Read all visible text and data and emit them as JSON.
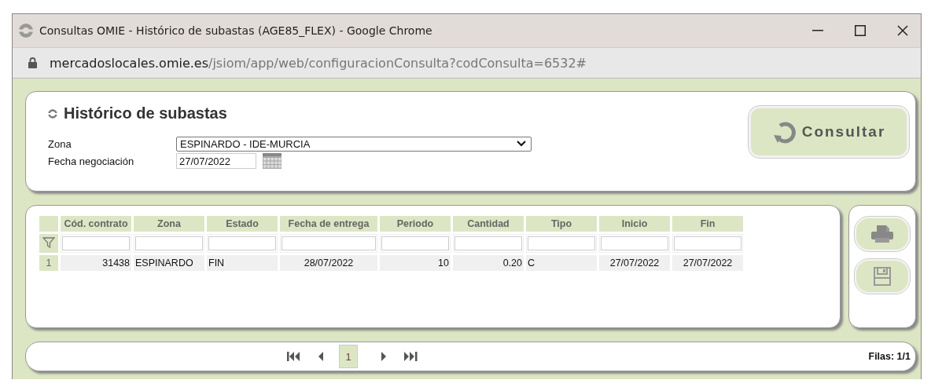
{
  "window": {
    "title": "Consultas OMIE - Histórico de subastas (AGE85_FLEX) - Google Chrome"
  },
  "address_bar": {
    "host": "mercadoslocales.omie.es",
    "path": "/jsiom/app/web/configuracionConsulta?codConsulta=6532#"
  },
  "form": {
    "title": "Histórico de subastas",
    "fields": [
      {
        "kind": "select",
        "label": "Zona",
        "value": "ESPINARDO - IDE-MURCIA"
      },
      {
        "kind": "date",
        "label": "Fecha negociación",
        "value": "27/07/2022"
      }
    ],
    "submit": "Consultar"
  },
  "table": {
    "columns": [
      {
        "label": "Cód. contrato",
        "kind": "number"
      },
      {
        "label": "Zona",
        "kind": "text"
      },
      {
        "label": "Estado",
        "kind": "text"
      },
      {
        "label": "Fecha de entrega",
        "kind": "date"
      },
      {
        "label": "Periodo",
        "kind": "number"
      },
      {
        "label": "Cantidad",
        "kind": "number"
      },
      {
        "label": "Tipo",
        "kind": "text"
      },
      {
        "label": "Inicio",
        "kind": "date"
      },
      {
        "label": "Fin",
        "kind": "date"
      }
    ],
    "rows": [
      {
        "index": "1",
        "cells": [
          "31438",
          "ESPINARDO",
          "FIN",
          "28/07/2022",
          "10",
          "0.20",
          "C",
          "27/07/2022",
          "27/07/2022"
        ]
      }
    ]
  },
  "pager": {
    "pages": [
      {
        "label": "1",
        "selected": true
      }
    ],
    "rows_info": "Filas: 1/1"
  }
}
